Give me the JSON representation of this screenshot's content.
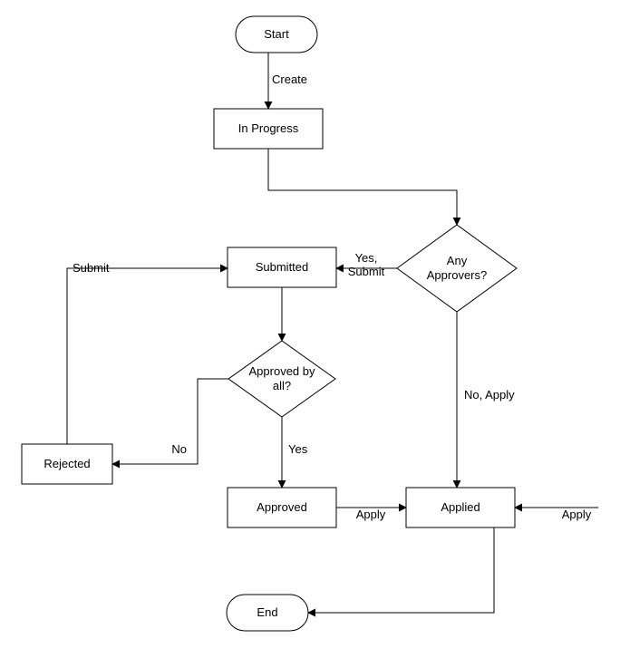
{
  "nodes": {
    "start": "Start",
    "in_progress": "In Progress",
    "any_approvers": "Any Approvers?",
    "submitted": "Submitted",
    "approved_by_all": "Approved by all?",
    "rejected": "Rejected",
    "approved": "Approved",
    "applied": "Applied",
    "end": "End"
  },
  "edges": {
    "create": "Create",
    "yes_submit": "Yes, Submit",
    "no_apply": "No, Apply",
    "submit": "Submit",
    "no": "No",
    "yes": "Yes",
    "apply_left": "Apply",
    "apply_right": "Apply"
  }
}
